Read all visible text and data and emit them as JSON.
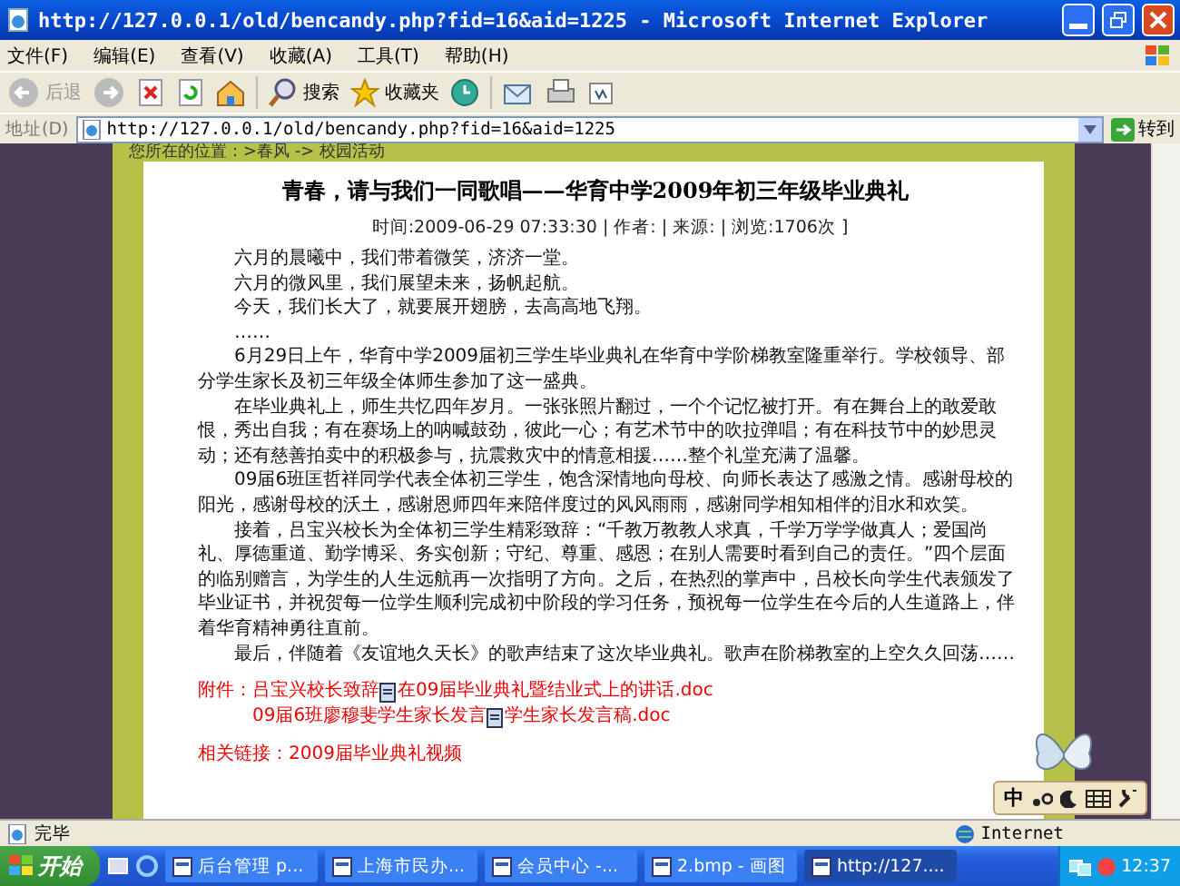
{
  "window": {
    "title": "http://127.0.0.1/old/bencandy.php?fid=16&aid=1225 - Microsoft Internet Explorer"
  },
  "menu": [
    "文件(F)",
    "编辑(E)",
    "查看(V)",
    "收藏(A)",
    "工具(T)",
    "帮助(H)"
  ],
  "toolbar": {
    "back": "后退",
    "search": "搜索",
    "favorites": "收藏夹"
  },
  "address": {
    "label": "地址(D)",
    "value": "http://127.0.0.1/old/bencandy.php?fid=16&aid=1225",
    "go": "转到"
  },
  "page": {
    "breadcrumb": "您所在的位置：>春风 -> 校园活动",
    "title": "青春，请与我们一同歌唱——华育中学2009年初三年级毕业典礼",
    "meta": "时间:2009-06-29 07:33:30 | 作者: | 来源: | 浏览:1706次 ]",
    "poem": [
      "六月的晨曦中，我们带着微笑，济济一堂。",
      "六月的微风里，我们展望未来，扬帆起航。",
      "今天，我们长大了，就要展开翅膀，去高高地飞翔。",
      "……"
    ],
    "paragraphs": [
      "6月29日上午，华育中学2009届初三学生毕业典礼在华育中学阶梯教室隆重举行。学校领导、部分学生家长及初三年级全体师生参加了这一盛典。",
      "在毕业典礼上，师生共忆四年岁月。一张张照片翻过，一个个记忆被打开。有在舞台上的敢爱敢恨，秀出自我；有在赛场上的呐喊鼓劲，彼此一心；有艺术节中的吹拉弹唱；有在科技节中的妙思灵动；还有慈善拍卖中的积极参与，抗震救灾中的情意相援……整个礼堂充满了温馨。",
      "09届6班匡哲祥同学代表全体初三学生，饱含深情地向母校、向师长表达了感激之情。感谢母校的阳光，感谢母校的沃土，感谢恩师四年来陪伴度过的风风雨雨，感谢同学相知相伴的泪水和欢笑。",
      "接着，吕宝兴校长为全体初三学生精彩致辞：“千教万教教人求真，千学万学学做真人；爱国尚礼、厚德重道、勤学博采、务实创新；守纪、尊重、感恩；在别人需要时看到自己的责任。”四个层面的临别赠言，为学生的人生远航再一次指明了方向。之后，在热烈的掌声中，吕校长向学生代表颁发了毕业证书，并祝贺每一位学生顺利完成初中阶段的学习任务，预祝每一位学生在今后的人生道路上，伴着华育精神勇往直前。",
      "最后，伴随着《友谊地久天长》的歌声结束了这次毕业典礼。歌声在阶梯教室的上空久久回荡……"
    ],
    "attachments_label": "附件：",
    "attachments": [
      {
        "name": "吕宝兴校长致辞",
        "file": "在09届毕业典礼暨结业式上的讲话.doc"
      },
      {
        "name": "09届6班廖穆斐学生家长发言",
        "file": "学生家长发言稿.doc"
      }
    ],
    "related": "相关链接：2009届毕业典礼视频"
  },
  "ime": {
    "label": "中"
  },
  "status": {
    "text": "完毕",
    "zone": "Internet"
  },
  "taskbar": {
    "start": "开始",
    "tasks": [
      {
        "label": "后台管理 p...",
        "selected": false
      },
      {
        "label": "上海市民办...",
        "selected": false
      },
      {
        "label": "会员中心 -...",
        "selected": false
      },
      {
        "label": "2.bmp - 画图",
        "selected": false
      },
      {
        "label": "http://127....",
        "selected": true
      }
    ],
    "clock": "12:37"
  }
}
